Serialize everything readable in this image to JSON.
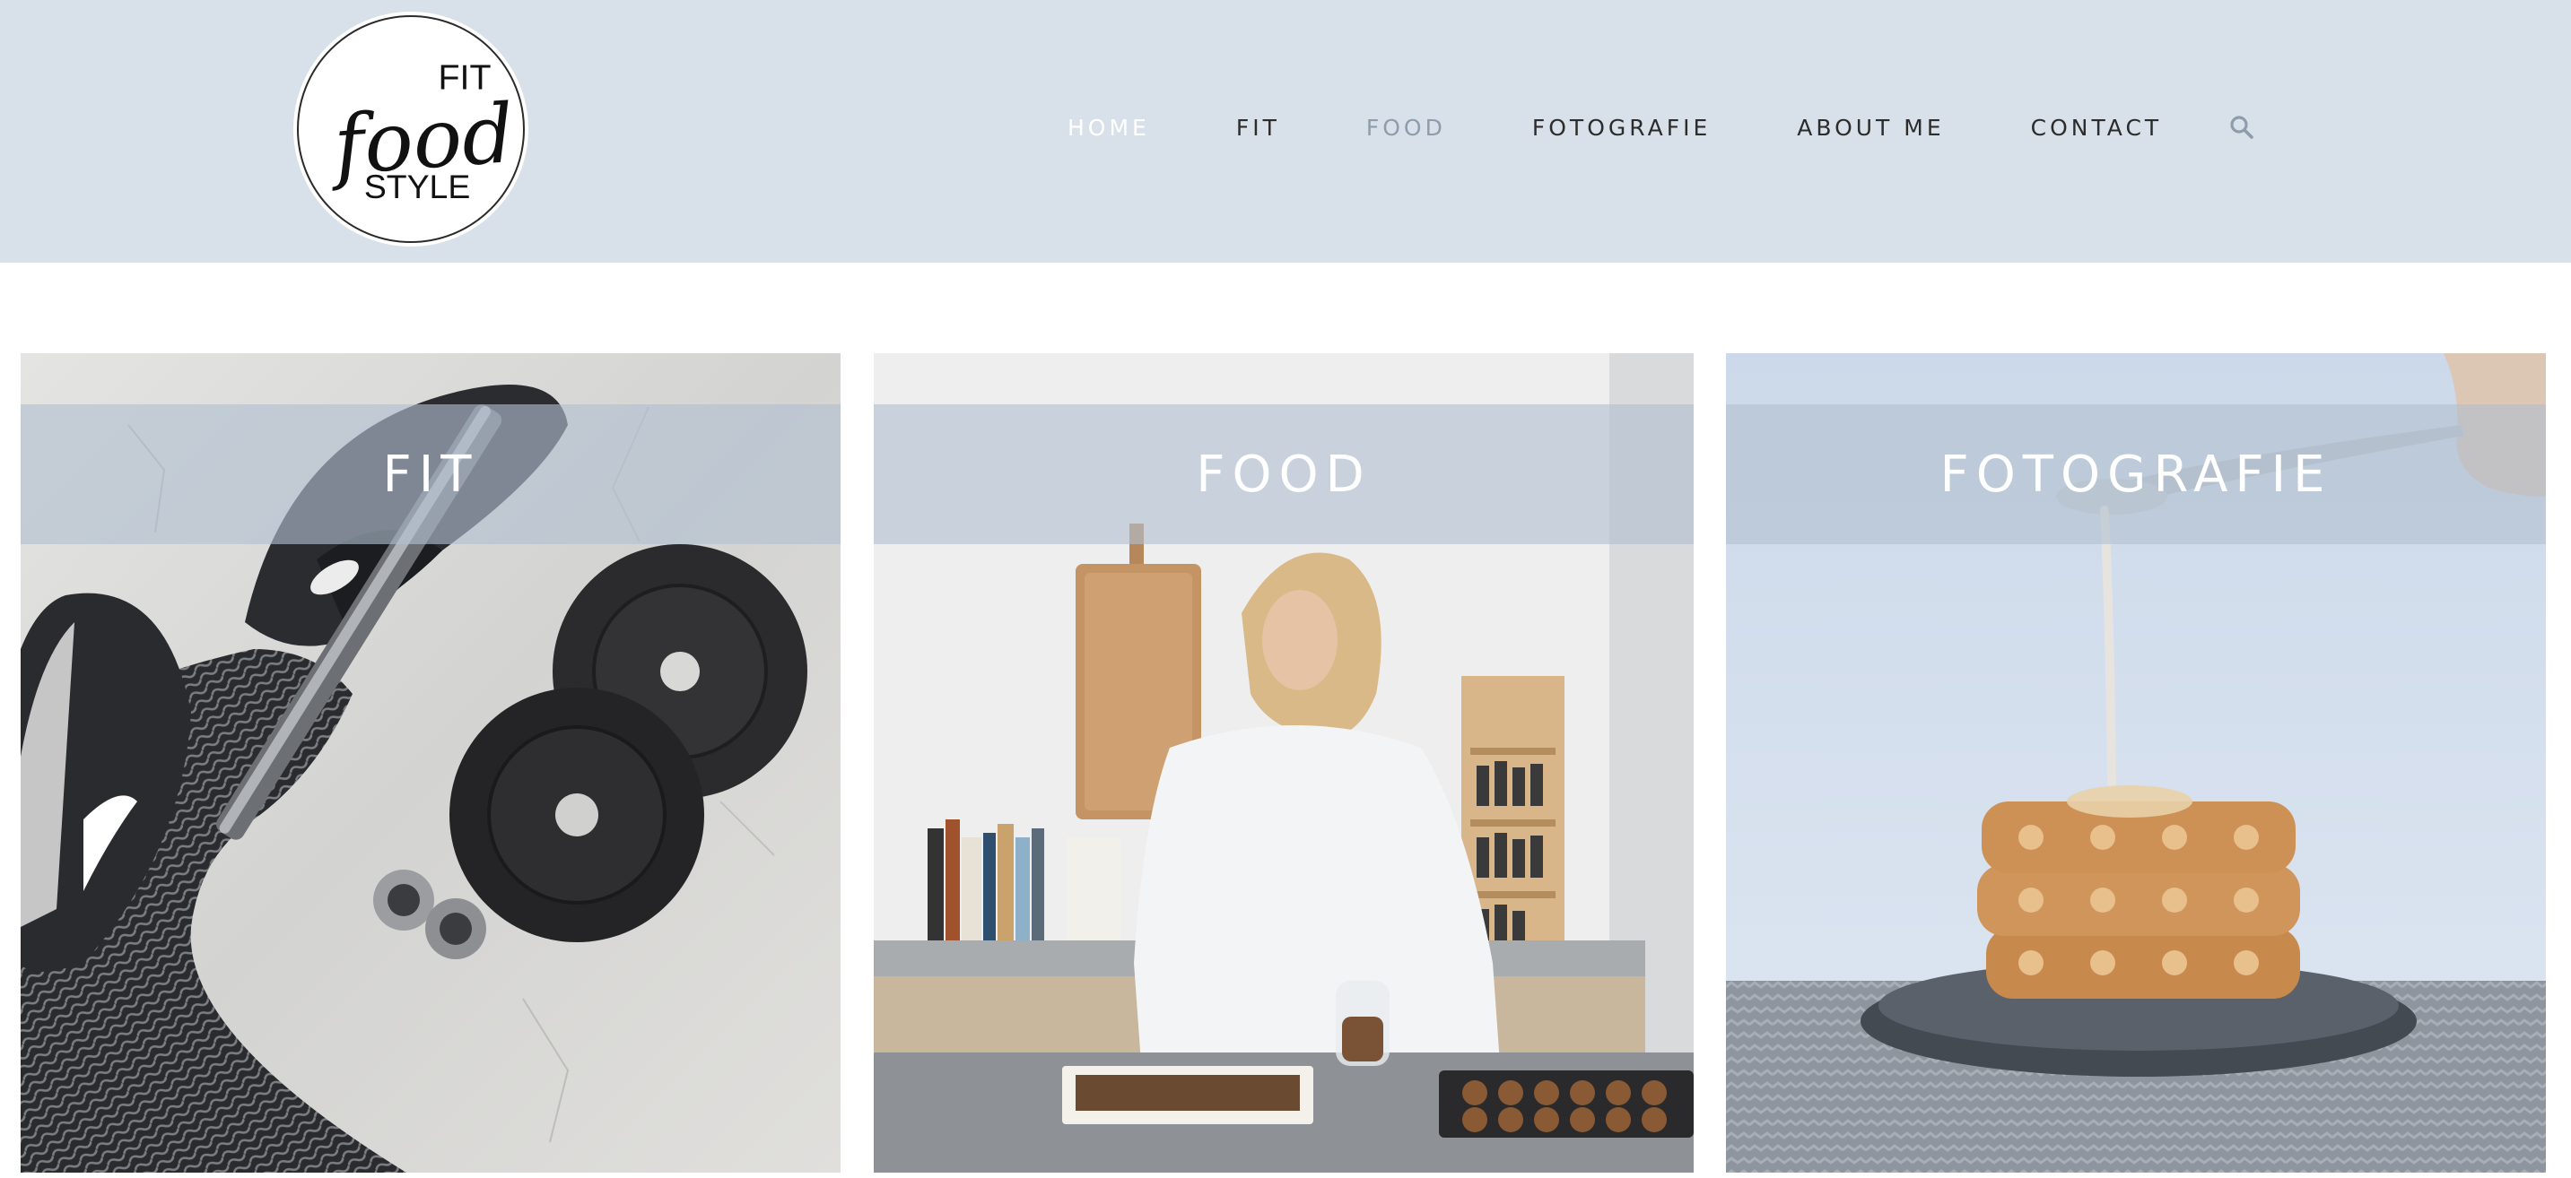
{
  "brand": {
    "logo_line_1": "FIT",
    "logo_line_2": "food",
    "logo_line_3": "STYLE"
  },
  "nav": {
    "items": [
      {
        "label": "HOME",
        "state": "hover-white"
      },
      {
        "label": "FIT",
        "state": "default"
      },
      {
        "label": "FOOD",
        "state": "active"
      },
      {
        "label": "FOTOGRAFIE",
        "state": "default"
      },
      {
        "label": "ABOUT ME",
        "state": "default"
      },
      {
        "label": "CONTACT",
        "state": "default"
      }
    ],
    "search_icon": "search-icon"
  },
  "tiles": [
    {
      "label": "FIT",
      "image": "dumbbell-and-sneakers-photo"
    },
    {
      "label": "FOOD",
      "image": "woman-baking-in-kitchen-photo"
    },
    {
      "label": "FOTOGRAFIE",
      "image": "syrup-on-waffles-photo"
    }
  ],
  "colors": {
    "header_bg": "#d8e1e9",
    "nav_text": "#2c2c2c",
    "nav_active": "#8e9cab",
    "band_overlay": "#b2c0d0"
  }
}
